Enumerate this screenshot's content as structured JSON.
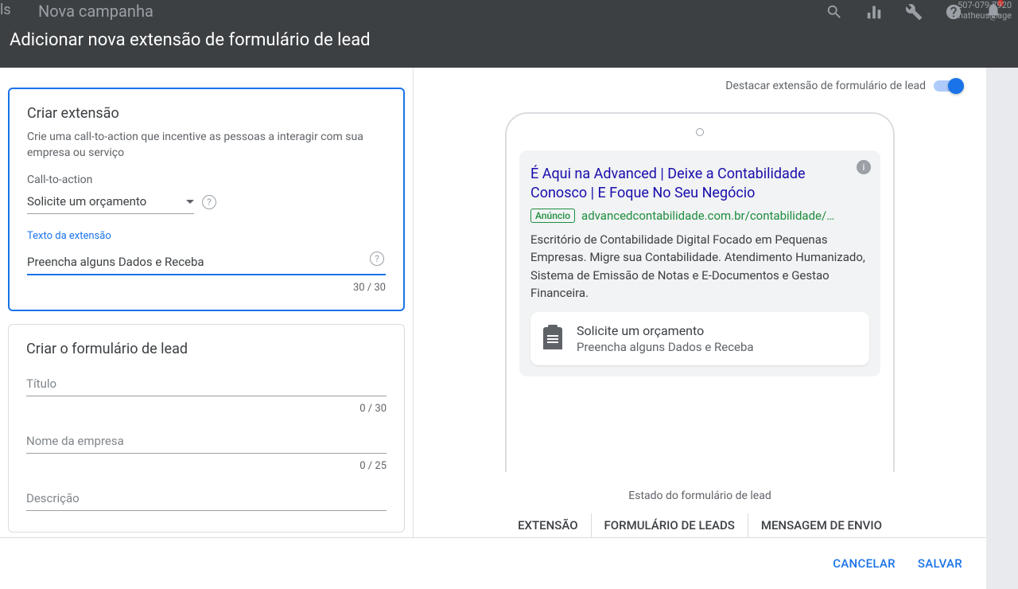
{
  "header": {
    "campaign_faded": "Nova campanha",
    "ls": "ls",
    "modal_title": "Adicionar nova extensão de formulário de lead",
    "account_id": "507-079-7920",
    "account_email_partial": "matheus@age"
  },
  "left": {
    "create_ext": {
      "title": "Criar extensão",
      "desc": "Crie uma call-to-action que incentive as pessoas a interagir com sua empresa ou serviço",
      "cta_label": "Call-to-action",
      "cta_value": "Solicite um orçamento",
      "ext_text_label": "Texto da extensão",
      "ext_text_value": "Preencha alguns Dados e Receba",
      "ext_text_counter": "30 / 30"
    },
    "create_form": {
      "title": "Criar o formulário de lead",
      "title_field": "Título",
      "title_counter": "0 / 30",
      "company_field": "Nome da empresa",
      "company_counter": "0 / 25",
      "desc_field": "Descrição"
    }
  },
  "right": {
    "toggle_label": "Destacar extensão de formulário de lead",
    "ad": {
      "title": "É Aqui na Advanced | Deixe a Contabilidade Conosco | E Foque No Seu Negócio",
      "badge": "Anúncio",
      "url": "advancedcontabilidade.com.br/contabilidade/d…",
      "desc": "Escritório de Contabilidade Digital Focado em Pequenas Empresas. Migre sua Contabilidade. Atendimento Humanizado, Sistema de Emissão de Notas e E-Documentos e Gestao Financeira.",
      "cta_title": "Solicite um orçamento",
      "cta_sub": "Preencha alguns Dados e Receba"
    },
    "state_label": "Estado do formulário de lead",
    "tabs": [
      "EXTENSÃO",
      "FORMULÁRIO DE LEADS",
      "MENSAGEM DE ENVIO"
    ]
  },
  "footer": {
    "cancel": "CANCELAR",
    "save": "SALVAR"
  }
}
